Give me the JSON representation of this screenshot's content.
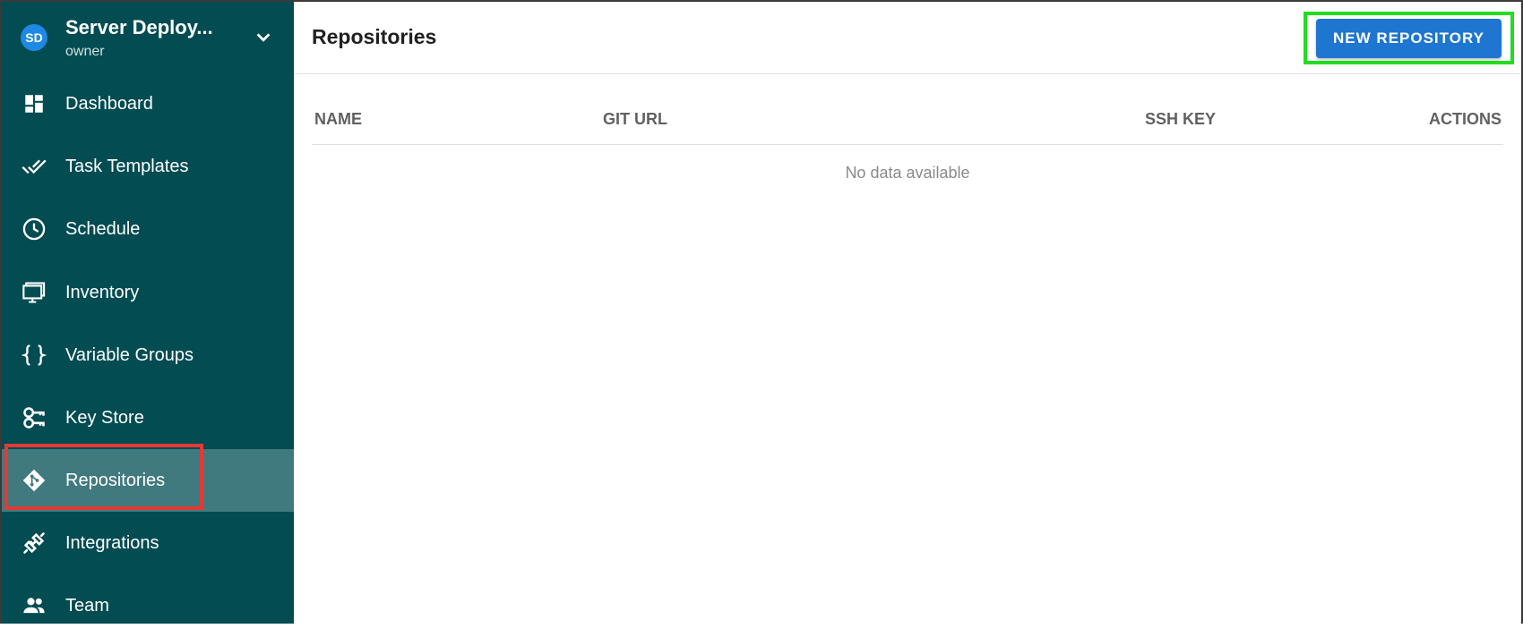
{
  "project": {
    "initials": "SD",
    "name": "Server Deploy...",
    "role": "owner"
  },
  "sidebar": {
    "items": [
      {
        "label": "Dashboard",
        "icon": "dashboard-icon"
      },
      {
        "label": "Task Templates",
        "icon": "done-all-icon"
      },
      {
        "label": "Schedule",
        "icon": "clock-icon"
      },
      {
        "label": "Inventory",
        "icon": "monitor-icon"
      },
      {
        "label": "Variable Groups",
        "icon": "braces-icon"
      },
      {
        "label": "Key Store",
        "icon": "key-icon"
      },
      {
        "label": "Repositories",
        "icon": "git-icon",
        "active": true
      },
      {
        "label": "Integrations",
        "icon": "plug-icon"
      },
      {
        "label": "Team",
        "icon": "team-icon"
      }
    ]
  },
  "toolbar": {
    "title": "Repositories",
    "new_button": "NEW REPOSITORY"
  },
  "table": {
    "columns": [
      "NAME",
      "GIT URL",
      "SSH KEY",
      "ACTIONS"
    ],
    "empty_text": "No data available"
  },
  "colors": {
    "sidebar_bg": "#024c52",
    "active_item_bg": "#417a7e",
    "primary_button": "#1e76d0",
    "avatar": "#1e88e5",
    "highlight_red": "#e53935",
    "highlight_green": "#22dd22"
  }
}
